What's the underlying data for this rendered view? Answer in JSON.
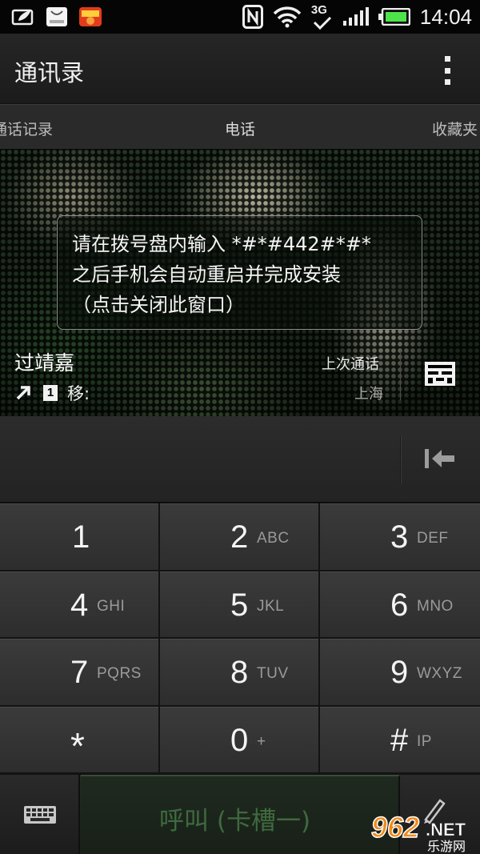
{
  "status_bar": {
    "time": "14:04",
    "icons": [
      "leaf-notification-icon",
      "taobao-icon",
      "game-app-icon",
      "nfc-icon",
      "wifi-icon",
      "3g-icon",
      "signal-icon",
      "battery-icon"
    ],
    "network": "3G"
  },
  "action_bar": {
    "title": "通讯录",
    "menu_icon": "overflow-menu-icon"
  },
  "tabs": [
    {
      "label": "通话记录"
    },
    {
      "label": "电话"
    },
    {
      "label": "收藏夹"
    }
  ],
  "toast": {
    "line1": "请在拨号盘内输入 *#*#442#*#*",
    "line2": "之后手机会自动重启并完成安装",
    "line3": "（点击关闭此窗口）"
  },
  "contact": {
    "name": "过靖嘉",
    "call_type_icon": "outgoing-call-icon",
    "sim": "1",
    "number_type": "移:",
    "last_call_label": "上次通话",
    "location": "上海"
  },
  "input": {
    "value": ""
  },
  "keypad": {
    "keys": [
      {
        "digit": "1",
        "letters": ""
      },
      {
        "digit": "2",
        "letters": "ABC"
      },
      {
        "digit": "3",
        "letters": "DEF"
      },
      {
        "digit": "4",
        "letters": "GHI"
      },
      {
        "digit": "5",
        "letters": "JKL"
      },
      {
        "digit": "6",
        "letters": "MNO"
      },
      {
        "digit": "7",
        "letters": "PQRS"
      },
      {
        "digit": "8",
        "letters": "TUV"
      },
      {
        "digit": "9",
        "letters": "WXYZ"
      },
      {
        "digit": "*",
        "letters": ""
      },
      {
        "digit": "0",
        "letters": "+"
      },
      {
        "digit": "#",
        "letters": "IP"
      }
    ]
  },
  "bottom_bar": {
    "call_label": "呼叫 (卡槽一)"
  },
  "watermark": {
    "brand": "962",
    "suffix": ".NET",
    "subtitle": "乐游网"
  },
  "colors": {
    "call_text": "#3f6a3f",
    "accent_watermark": "#f08a1c"
  }
}
